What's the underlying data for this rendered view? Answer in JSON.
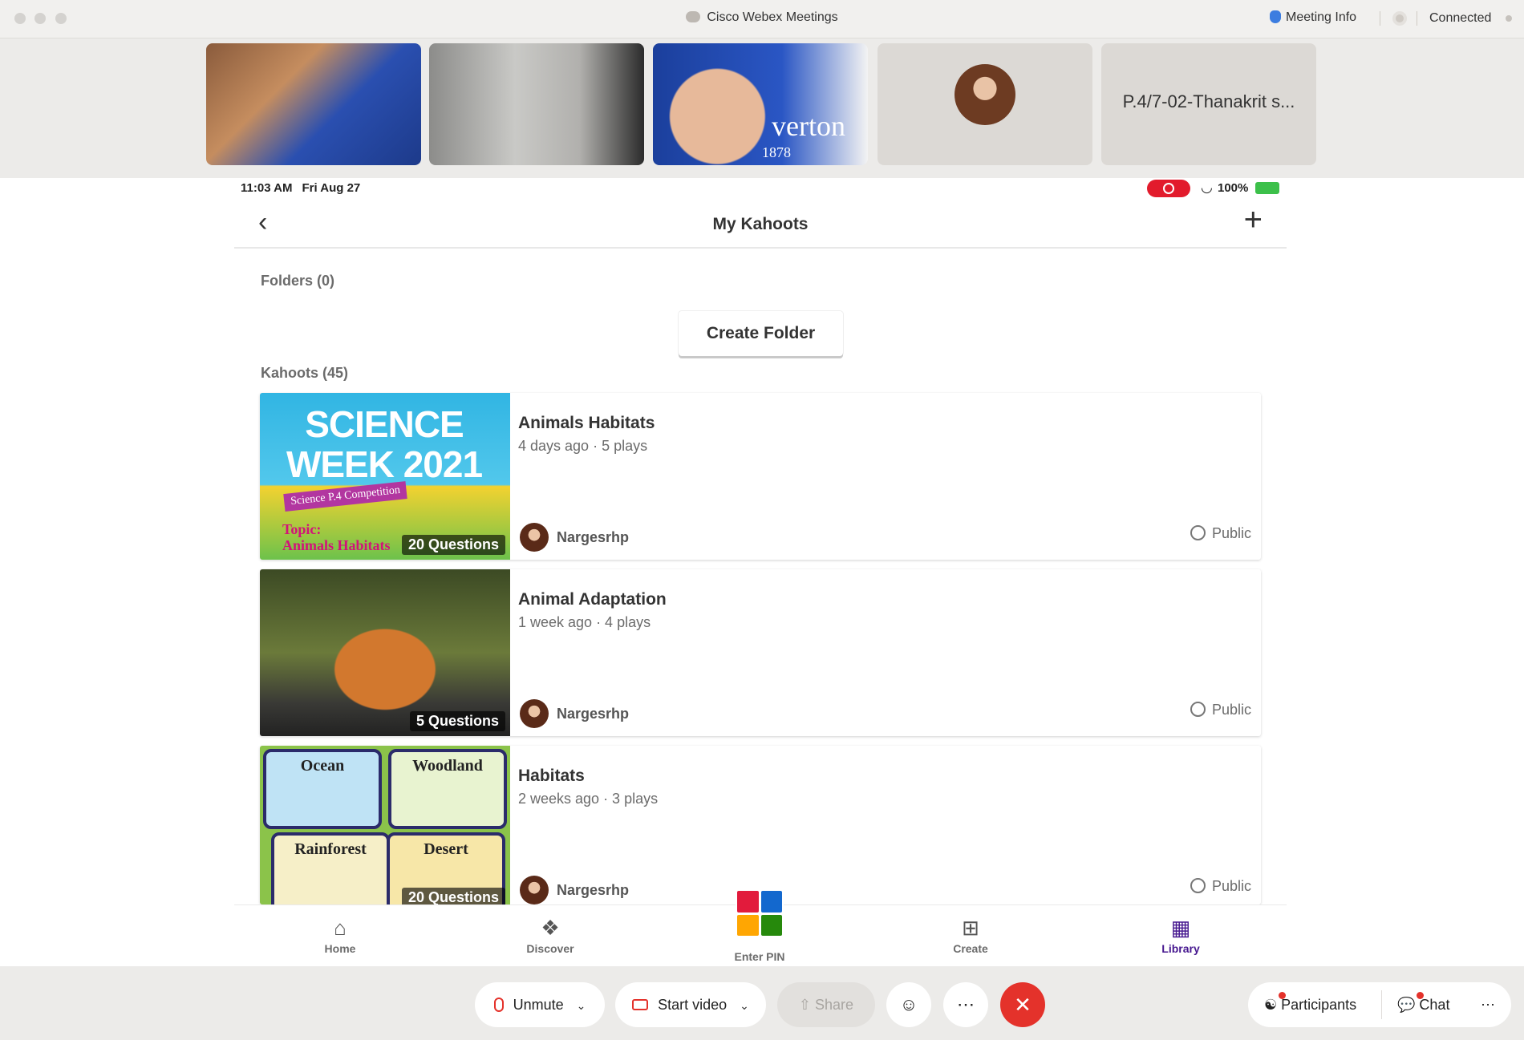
{
  "window": {
    "title": "Cisco Webex Meetings",
    "meeting_info": "Meeting Info",
    "status": "Connected"
  },
  "participants_strip": {
    "named_tile": "P.4/7-02-Thanakrit s...",
    "tile3_text": "verton",
    "tile3_year": "1878"
  },
  "ipad": {
    "time": "11:03 AM",
    "date": "Fri Aug 27",
    "battery": "100%"
  },
  "kahoot": {
    "title": "My Kahoots",
    "folders_label": "Folders (0)",
    "create_folder": "Create Folder",
    "kahoots_label": "Kahoots (45)",
    "items": [
      {
        "title": "Animals Habitats",
        "meta": "4 days ago · 5 plays",
        "questions": "20 Questions",
        "author": "Nargesrhp",
        "visibility": "Public",
        "thumb_title": "SCIENCE WEEK 2021",
        "thumb_sub": "Science P.4 Competition",
        "thumb_topic": "Topic:",
        "thumb_topic_name": "Animals Habitats"
      },
      {
        "title": "Animal Adaptation",
        "meta": "1 week ago · 4 plays",
        "questions": "5 Questions",
        "author": "Nargesrhp",
        "visibility": "Public"
      },
      {
        "title": "Habitats",
        "meta": "2 weeks ago · 3 plays",
        "questions": "20 Questions",
        "author": "Nargesrhp",
        "visibility": "Public",
        "thumb_labels": [
          "Ocean",
          "Woodland",
          "Rainforest",
          "Desert"
        ]
      }
    ],
    "tabs": [
      {
        "label": "Home",
        "icon": "home-icon"
      },
      {
        "label": "Discover",
        "icon": "compass-icon"
      },
      {
        "label": "Enter PIN",
        "icon": "pin-grid-icon"
      },
      {
        "label": "Create",
        "icon": "plus-square-icon"
      },
      {
        "label": "Library",
        "icon": "grid-icon"
      }
    ]
  },
  "controls": {
    "unmute": "Unmute",
    "start_video": "Start video",
    "share": "Share",
    "participants": "Participants",
    "chat": "Chat"
  },
  "colors": {
    "kahoot_purple": "#46178f",
    "end_red": "#e4322b",
    "pin_red": "#e21b3c",
    "pin_blue": "#1368ce",
    "pin_yellow": "#ffa602",
    "pin_green": "#26890c"
  }
}
